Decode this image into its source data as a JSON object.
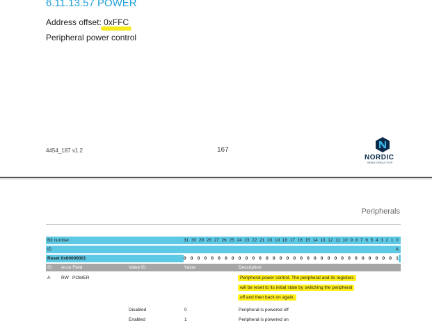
{
  "page1": {
    "section_title": "6.11.13.57 POWER",
    "address_label": "Address offset: ",
    "address_value": "0xFFC",
    "register_description": "Peripheral power control",
    "footer_doc": "4454_187 v1.2",
    "footer_page": "167",
    "logo_word": "NORDIC",
    "logo_sub": "SEMICONDUCTOR"
  },
  "page2": {
    "running_head": "Peripherals",
    "table": {
      "bit_number_label": "Bit number",
      "bit_numbers": [
        "31",
        "30",
        "29",
        "28",
        "27",
        "26",
        "25",
        "24",
        "23",
        "22",
        "21",
        "20",
        "19",
        "18",
        "17",
        "16",
        "15",
        "14",
        "13",
        "12",
        "11",
        "10",
        "9",
        "8",
        "7",
        "6",
        "5",
        "4",
        "3",
        "2",
        "1",
        "0"
      ],
      "id_label": "ID",
      "id_bit0": "A",
      "reset_label": "Reset 0x00000001",
      "reset_bits": [
        "0",
        "0",
        "0",
        "0",
        "0",
        "0",
        "0",
        "0",
        "0",
        "0",
        "0",
        "0",
        "0",
        "0",
        "0",
        "0",
        "0",
        "0",
        "0",
        "0",
        "0",
        "0",
        "0",
        "0",
        "0",
        "0",
        "0",
        "0",
        "0",
        "0",
        "0",
        "1"
      ],
      "header": {
        "id": "ID",
        "acce_field": "Acce Field",
        "value_id": "Value ID",
        "value": "Value",
        "description": "Description"
      },
      "field": {
        "id": "A",
        "access": "RW",
        "name": "POWER",
        "description_lines": [
          "Peripheral power control. The peripheral and its registers",
          "will be reset to its initial state by switching the peripheral",
          "off and then back on again."
        ]
      },
      "values": [
        {
          "value_id": "Disabled",
          "value": "0",
          "description": "Peripheral is powered off"
        },
        {
          "value_id": "Enabled",
          "value": "1",
          "description": "Peripheral is powered on"
        }
      ]
    }
  },
  "colors": {
    "title_blue": "#1f9fd6",
    "table_cyan": "#5ec9e5",
    "header_gray": "#a6a6a6",
    "highlight_yellow": "#ffef1a"
  }
}
